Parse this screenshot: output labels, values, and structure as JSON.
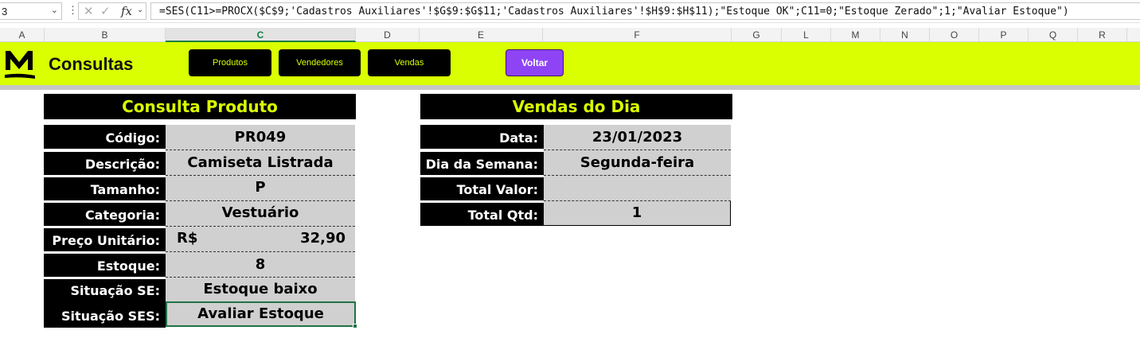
{
  "formula_bar": {
    "name_box": "3",
    "formula": "=SES(C11>=PROCX($C$9;'Cadastros Auxiliares'!$G$9:$G$11;'Cadastros Auxiliares'!$H$9:$H$11);\"Estoque OK\";C11=0;\"Estoque Zerado\";1;\"Avaliar Estoque\")"
  },
  "columns": [
    "A",
    "B",
    "C",
    "D",
    "E",
    "F",
    "G",
    "L",
    "M",
    "N",
    "O",
    "P",
    "Q",
    "R"
  ],
  "banner": {
    "title": "Consultas",
    "nav": [
      "Produtos",
      "Vendedores",
      "Vendas"
    ],
    "voltar": "Voltar"
  },
  "consulta_produto": {
    "title": "Consulta Produto",
    "rows": [
      {
        "label": "Código:",
        "value": "PR049"
      },
      {
        "label": "Descrição:",
        "value": "Camiseta Listrada"
      },
      {
        "label": "Tamanho:",
        "value": "P"
      },
      {
        "label": "Categoria:",
        "value": "Vestuário"
      },
      {
        "label": "Preço Unitário:",
        "currency": "R$",
        "value": "32,90"
      },
      {
        "label": "Estoque:",
        "value": "8"
      },
      {
        "label": "Situação SE:",
        "value": "Estoque baixo"
      },
      {
        "label": "Situação SES:",
        "value": "Avaliar Estoque"
      }
    ]
  },
  "vendas_dia": {
    "title": "Vendas do Dia",
    "rows": [
      {
        "label": "Data:",
        "value": "23/01/2023"
      },
      {
        "label": "Dia da Semana:",
        "value": "Segunda-feira"
      },
      {
        "label": "Total Valor:",
        "value": ""
      },
      {
        "label": "Total Qtd:",
        "value": "1"
      }
    ]
  },
  "colors": {
    "accent": "#d9ff00",
    "voltar": "#8e44f5",
    "selection": "#217346"
  }
}
